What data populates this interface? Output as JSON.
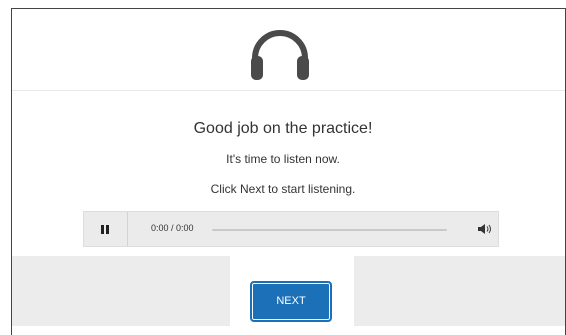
{
  "content": {
    "title": "Good job on the practice!",
    "line1": "It's time to listen now.",
    "line2": "Click Next to start listening."
  },
  "player": {
    "time_display": "0:00 / 0:00",
    "state": "playing",
    "progress": 0
  },
  "buttons": {
    "next_label": "NEXT"
  },
  "icons": {
    "header": "headphones-icon",
    "pause": "pause-icon",
    "volume": "volume-icon"
  },
  "colors": {
    "accent": "#1b70b8",
    "icon": "#4a4a4a",
    "player_bg": "#ebebeb"
  }
}
